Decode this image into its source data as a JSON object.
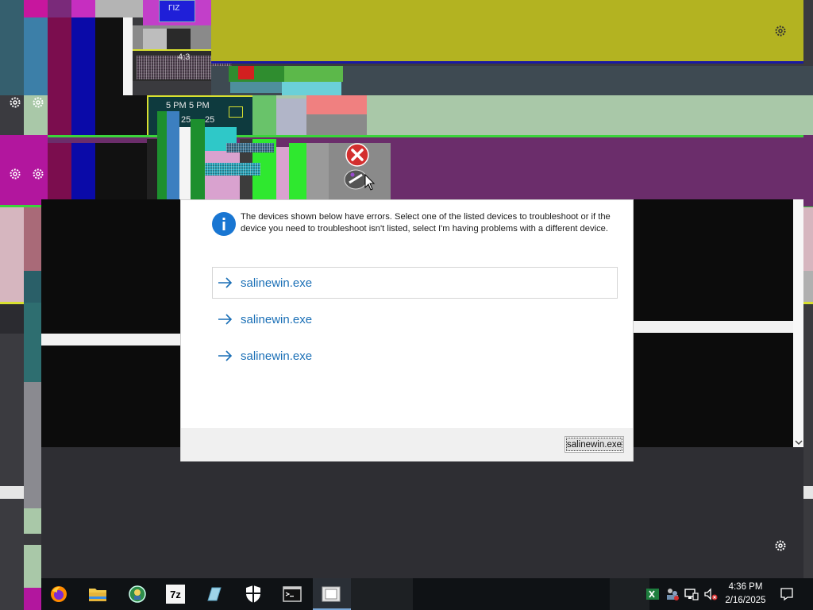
{
  "glitch": {
    "label_43": "4:3",
    "label_time1": "5 PM",
    "label_time2": "5 PM",
    "label_25a": "25",
    "label_25b": "25",
    "top_box_label": "ΓIZ"
  },
  "dialog": {
    "message": "The devices shown below have errors. Select one of the listed devices to troubleshoot or if the device you need to troubleshoot isn't listed, select I'm having problems with a different device.",
    "items": [
      {
        "label": "salinewin.exe"
      },
      {
        "label": "salinewin.exe"
      },
      {
        "label": "salinewin.exe"
      }
    ],
    "footer_button": "salinewin.exe"
  },
  "taskbar": {
    "apps": [
      {
        "icon": "firefox-icon"
      },
      {
        "icon": "file-explorer-icon"
      },
      {
        "icon": "app-icon"
      },
      {
        "icon": "7zip-icon",
        "text": "7z"
      },
      {
        "icon": "notepad-icon"
      },
      {
        "icon": "security-shield-icon"
      },
      {
        "icon": "terminal-icon"
      },
      {
        "icon": "dialog-window-icon"
      }
    ],
    "clock": {
      "time": "4:36 PM",
      "date": "2/16/2025"
    }
  },
  "colors": {
    "link": "#1a6fb6",
    "info_blue": "#1976d2",
    "error_red": "#d32f2f",
    "olive": "#b3b321",
    "purple": "#6b2d6b"
  }
}
